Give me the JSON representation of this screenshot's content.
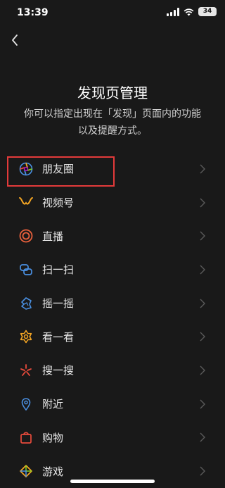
{
  "status": {
    "time": "13:39",
    "battery": "34"
  },
  "header": {
    "title": "发现页管理",
    "description": "你可以指定出现在「发现」页面内的功能以及提醒方式。"
  },
  "items": [
    {
      "label": "朋友圈",
      "icon": "moments-icon"
    },
    {
      "label": "视频号",
      "icon": "channels-icon"
    },
    {
      "label": "直播",
      "icon": "live-icon"
    },
    {
      "label": "扫一扫",
      "icon": "scan-icon"
    },
    {
      "label": "摇一摇",
      "icon": "shake-icon"
    },
    {
      "label": "看一看",
      "icon": "top-stories-icon"
    },
    {
      "label": "搜一搜",
      "icon": "search-icon"
    },
    {
      "label": "附近",
      "icon": "nearby-icon"
    },
    {
      "label": "购物",
      "icon": "shopping-icon"
    },
    {
      "label": "游戏",
      "icon": "games-icon"
    }
  ],
  "colors": {
    "background": "#191919",
    "highlight_border": "#e33a3a"
  }
}
